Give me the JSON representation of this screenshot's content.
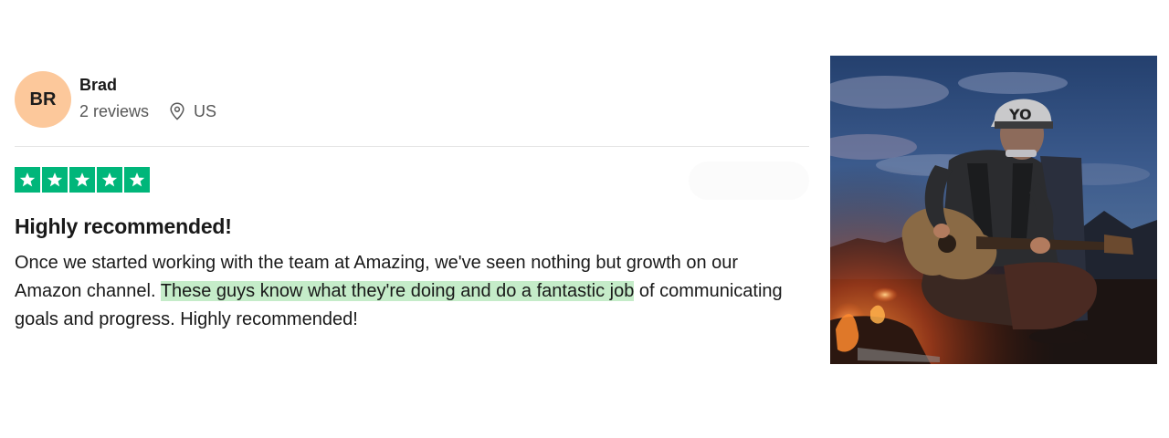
{
  "reviewer": {
    "initials": "BR",
    "name": "Brad",
    "review_count": "2 reviews",
    "country": "US",
    "avatar_color": "#fcc89b"
  },
  "review": {
    "rating": 5,
    "rating_max": 5,
    "star_color": "#00b67a",
    "title": "Highly recommended!",
    "body_before": "Once we started working with the team at Amazing, we've seen nothing but growth on our Amazon channel. ",
    "body_highlight": "These guys know what they're doing and do a fantastic job",
    "body_after": " of communicating goals and progress. Highly recommended!",
    "highlight_color": "#c5ecc9"
  },
  "photo": {
    "cap_text": "YO"
  }
}
